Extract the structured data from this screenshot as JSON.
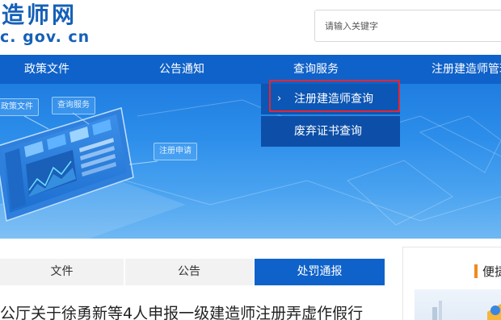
{
  "header": {
    "logo_main": "造师网",
    "logo_sub": "c. gov. cn",
    "search_placeholder": "请输入关键字"
  },
  "nav": {
    "items": [
      {
        "label": "政策文件"
      },
      {
        "label": "公告通知"
      },
      {
        "label": "查询服务"
      },
      {
        "label": "注册建造师管理"
      }
    ]
  },
  "dropdown": {
    "items": [
      {
        "label": "注册建造师查询",
        "arrow": "›"
      },
      {
        "label": "废弃证书查询"
      }
    ]
  },
  "banner": {
    "tags": [
      "政策文件",
      "查询服务",
      "注册申请"
    ]
  },
  "tabs": [
    {
      "label": "文件"
    },
    {
      "label": "公告"
    },
    {
      "label": "处罚通报"
    }
  ],
  "sidebar": {
    "title": "便捷"
  },
  "news": {
    "headline": "公厅关于徐勇新等4人申报一级建造师注册弄虚作假行"
  },
  "colors": {
    "primary": "#0f62c9",
    "logo": "#1560b8",
    "highlight_border": "#e8252e",
    "accent_orange": "#f08a1c"
  }
}
